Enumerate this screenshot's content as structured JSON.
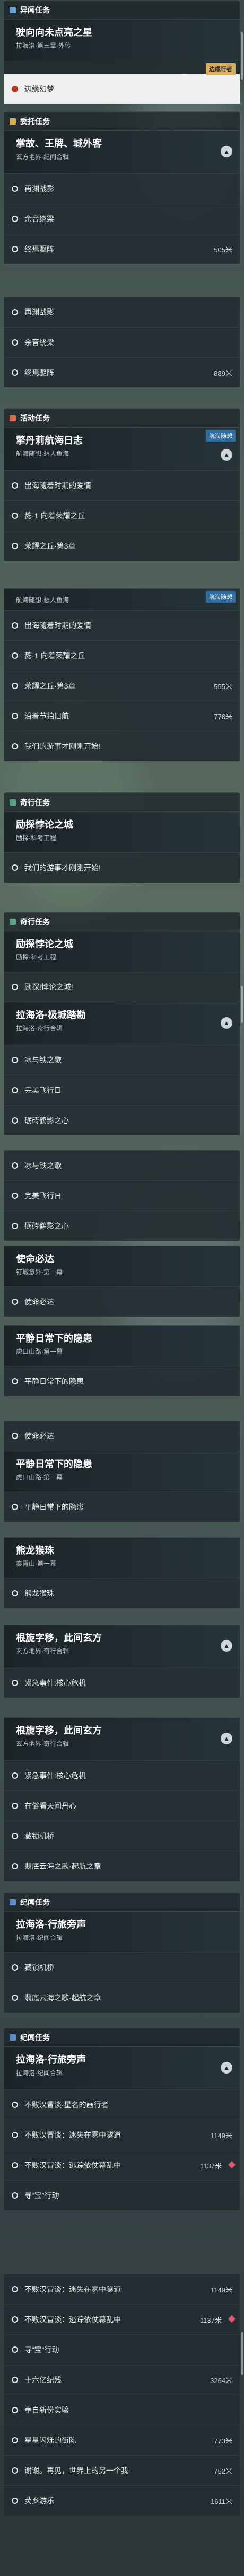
{
  "colors": {
    "world": "#6aa0d8",
    "daily": "#d9ad55",
    "event": "#d96b4a",
    "secret": "#a67ec6",
    "legend": "#5aa28a",
    "seasonal": "#5b8cc4"
  },
  "s1": {
    "header": "异闻任务",
    "title": "驶向向未点亮之星",
    "sub": "拉海洛·第三章·外传",
    "tag": "边缘行者",
    "row": "边缘幻梦"
  },
  "s2": {
    "header": "委托任务",
    "title": "掌故、王牌、城外客",
    "sub": "玄方地界·纪闻合辑",
    "rows": [
      {
        "t": "再渊战影",
        "d": ""
      },
      {
        "t": "余音绕梁",
        "d": ""
      },
      {
        "t": "终焉驱阵",
        "d": "505米"
      }
    ]
  },
  "s2b": {
    "rows": [
      {
        "t": "再渊战影",
        "d": ""
      },
      {
        "t": "余音绕梁",
        "d": ""
      },
      {
        "t": "终焉驱阵",
        "d": "889米"
      }
    ]
  },
  "s3": {
    "header": "活动任务",
    "title": "擎丹莉航海日志",
    "sub": "航海随想·愁人鱼海",
    "tag": "航海随想",
    "rows": [
      {
        "t": "出海随着时期的爱情",
        "d": ""
      },
      {
        "t": "懿·1 向着荣耀之丘",
        "d": ""
      },
      {
        "t": "荣耀之丘·第3章",
        "d": ""
      }
    ]
  },
  "s3b": {
    "title": "航海随想·愁人鱼海",
    "tag": "航海随想",
    "rows": [
      {
        "t": "出海随着时期的爱情",
        "d": ""
      },
      {
        "t": "懿·1 向着荣耀之丘",
        "d": ""
      },
      {
        "t": "荣耀之丘·第3章",
        "d": "555米"
      },
      {
        "t": "沿着节拍旧航",
        "d": "776米"
      },
      {
        "t": "我们的游事才刚刚开始!",
        "d": ""
      }
    ]
  },
  "s4": {
    "header": "奇行任务",
    "title": "励探悖论之城",
    "sub": "励探·科考工程",
    "row": "我们的游事才刚刚开始!"
  },
  "s5": {
    "header": "奇行任务",
    "title": "励探悖论之城",
    "sub": "励探·科考工程",
    "row": "励探!悖论之城!",
    "title2": "拉海洛·极城踏勘",
    "sub2": "拉海洛·奇行合辑",
    "rows": [
      {
        "t": "冰与铁之歌",
        "d": ""
      },
      {
        "t": "完美飞行日",
        "d": ""
      },
      {
        "t": "砺砖鹤影之心",
        "d": ""
      }
    ]
  },
  "s5b": {
    "rows": [
      {
        "t": "冰与铁之歌",
        "d": ""
      },
      {
        "t": "完美飞行日",
        "d": ""
      },
      {
        "t": "砺砖鹤影之心",
        "d": ""
      }
    ]
  },
  "s6": {
    "title": "使命必达",
    "sub": "钉城意外·第一幕",
    "row": "使命必达"
  },
  "s7": {
    "title": "平静日常下的隐患",
    "sub": "虎口山路·第一幕",
    "row": "平静日常下的隐患"
  },
  "s8": {
    "row": "使命必达",
    "title": "平静日常下的隐患",
    "sub": "虎口山路·第一幕",
    "row2": "平静日常下的隐患"
  },
  "s9": {
    "title": "熊龙猴珠",
    "sub": "秦青山·第一幕",
    "row": "熊龙猴珠"
  },
  "s10": {
    "title": "根旋字移，此间玄方",
    "sub": "玄方地界·奇行合辑",
    "rows": [
      {
        "t": "紧急事件:核心危机",
        "d": ""
      }
    ]
  },
  "s11": {
    "title": "根旋字移，此间玄方",
    "sub": "玄方地界·奇行合辑",
    "rows": [
      {
        "t": "紧急事件:核心危机",
        "d": ""
      },
      {
        "t": "在俗看天间丹心",
        "d": ""
      },
      {
        "t": "藏锁机桥",
        "d": ""
      },
      {
        "t": "翡底云海之歌·起航之章",
        "d": ""
      }
    ]
  },
  "s12": {
    "header": "纪闻任务",
    "title": "拉海洛·行旅旁声",
    "sub": "拉海洛·纪闻合辑",
    "rows": [
      {
        "t": "藏锁机桥",
        "d": ""
      },
      {
        "t": "翡底云海之歌·起航之章",
        "d": ""
      }
    ]
  },
  "s13": {
    "header": "纪闻任务",
    "title": "拉海洛·行旅旁声",
    "sub": "拉海洛·纪闻合辑",
    "rows": [
      {
        "t": "不败汉冒谈·星名的画行者",
        "d": ""
      },
      {
        "t": "不败汉冒谈：迷失在雾中隧道",
        "d": "1149米"
      },
      {
        "t": "不败汉冒谈：逃踪依仗幕乱中",
        "d": "1137米"
      },
      {
        "t": "寻“宝”行动",
        "d": ""
      }
    ]
  },
  "s14": {
    "rows": [
      {
        "t": "不败汉冒谈：迷失在雾中隧道",
        "d": "1149米"
      },
      {
        "t": "不败汉冒谈：逃踪依仗幕乱中",
        "d": "1137米"
      },
      {
        "t": "寻“宝”行动",
        "d": ""
      },
      {
        "t": "十六亿纪残",
        "d": "3264米"
      },
      {
        "t": "奉自新份实验",
        "d": ""
      },
      {
        "t": "星星闪烁的街陈",
        "d": "773米"
      },
      {
        "t": "谢谢。再见，世界上的另一个我",
        "d": "752米"
      },
      {
        "t": "荧乡游乐",
        "d": "1611米"
      }
    ]
  }
}
